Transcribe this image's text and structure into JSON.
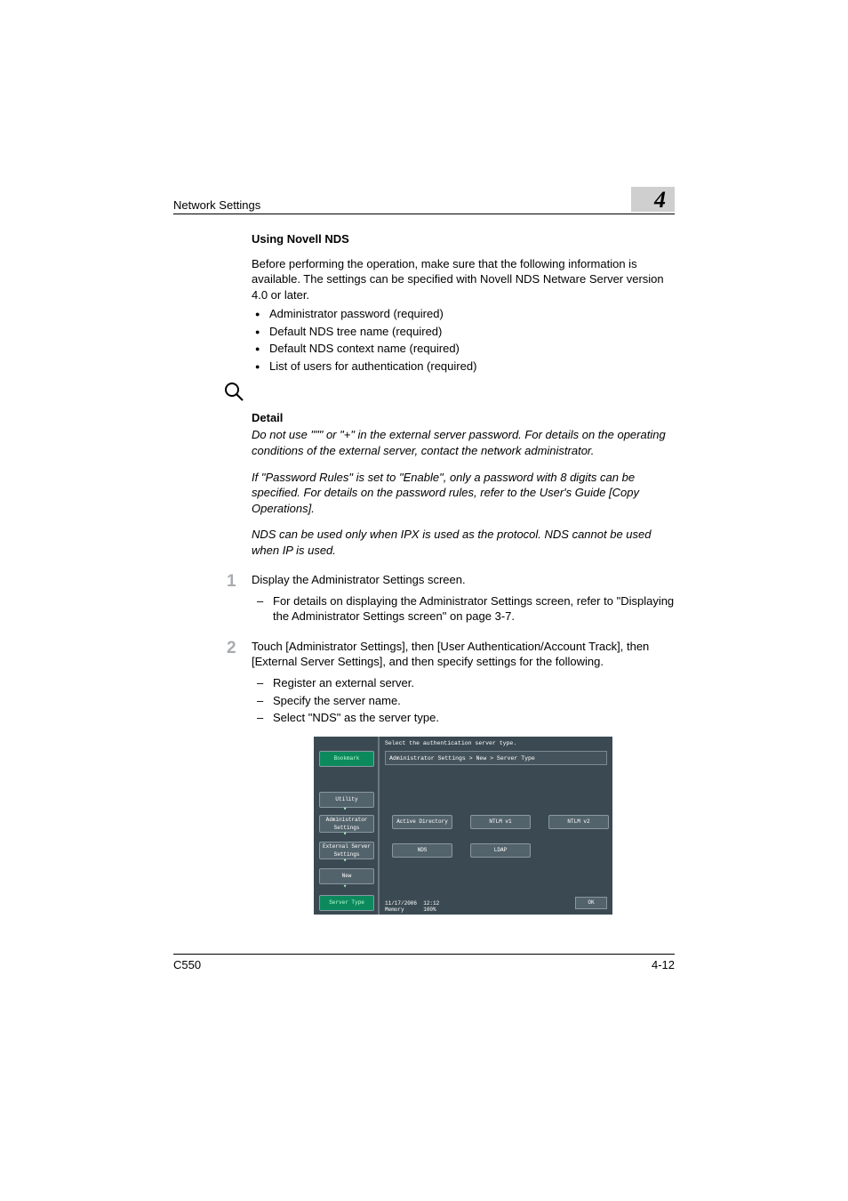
{
  "header": {
    "section_title": "Network Settings",
    "chapter_number": "4"
  },
  "body": {
    "heading": "Using Novell NDS",
    "intro": "Before performing the operation, make sure that the following information is available. The settings can be specified with Novell NDS Netware Server version 4.0 or later.",
    "reqs": [
      "Administrator password (required)",
      "Default NDS tree name (required)",
      "Default NDS context name (required)",
      "List of users for authentication (required)"
    ],
    "detail_heading": "Detail",
    "detail_p1": "Do not use \"\"\" or \"+\" in the external server password. For details on the operating conditions of the external server, contact the network administrator.",
    "detail_p2": "If \"Password Rules\" is set to \"Enable\", only a password with 8 digits can be specified. For details on the password rules, refer to the User's Guide [Copy Operations].",
    "detail_p3": "NDS can be used only when IPX is used as the protocol. NDS cannot be used when IP is used.",
    "step1_num": "1",
    "step1_text": "Display the Administrator Settings screen.",
    "step1_sub": "For details on displaying the Administrator Settings screen, refer to \"Displaying the Administrator Settings screen\" on page 3-7.",
    "step2_num": "2",
    "step2_text": "Touch [Administrator Settings], then [User Authentication/Account Track], then [External Server Settings], and then specify settings for the following.",
    "step2_subs": [
      "Register an external server.",
      "Specify the server name.",
      "Select \"NDS\" as the server type."
    ]
  },
  "screenshot": {
    "top_text": "Select the authentication server type.",
    "breadcrumb": "Administrator Settings > New > Server Type",
    "sidebar": {
      "bookmark": "Bookmark",
      "utility": "Utility",
      "admin": "Administrator Settings",
      "ext": "External Server Settings",
      "new": "New",
      "server_type": "Server Type"
    },
    "buttons": {
      "active_directory": "Active Directory",
      "ntlm_v1": "NTLM v1",
      "ntlm_v2": "NTLM v2",
      "nds": "NDS",
      "ldap": "LDAP",
      "ok": "OK"
    },
    "status": {
      "date": "11/17/2006",
      "time": "12:12",
      "mem_label": "Memory",
      "mem_value": "100%"
    }
  },
  "footer": {
    "model": "C550",
    "page": "4-12"
  }
}
